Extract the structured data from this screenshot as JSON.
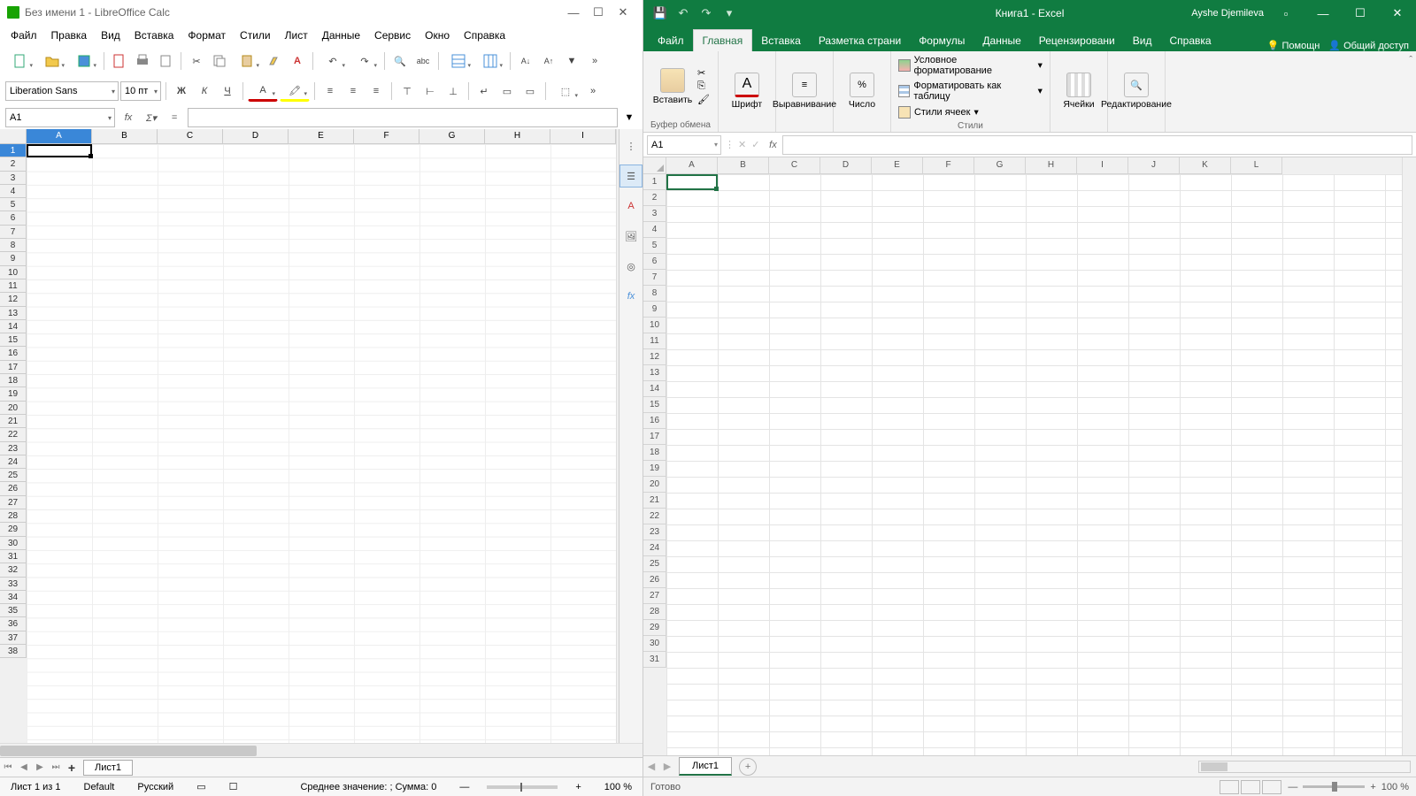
{
  "lo": {
    "title": "Без имени 1 - LibreOffice Calc",
    "menu": [
      "Файл",
      "Правка",
      "Вид",
      "Вставка",
      "Формат",
      "Стили",
      "Лист",
      "Данные",
      "Сервис",
      "Окно",
      "Справка"
    ],
    "font_name": "Liberation Sans",
    "font_size": "10 пт",
    "cell_ref": "A1",
    "cols": [
      "A",
      "B",
      "C",
      "D",
      "E",
      "F",
      "G",
      "H",
      "I"
    ],
    "row_count": 38,
    "sheet_tab": "Лист1",
    "sheet_plus": "+",
    "status": {
      "sheet": "Лист 1 из 1",
      "style": "Default",
      "lang": "Русский",
      "stats": "Среднее значение: ; Сумма: 0",
      "zoom": "100 %"
    }
  },
  "xl": {
    "title": "Книга1  -  Excel",
    "user": "Ayshe Djemileva",
    "tabs": [
      "Файл",
      "Главная",
      "Вставка",
      "Разметка страни",
      "Формулы",
      "Данные",
      "Рецензировани",
      "Вид",
      "Справка"
    ],
    "help": "Помощн",
    "share": "Общий доступ",
    "groups": {
      "clipboard": "Буфер обмена",
      "clipboard_btn": "Вставить",
      "font": "Шрифт",
      "align": "Выравнивание",
      "number": "Число",
      "styles": "Стили",
      "cond": "Условное форматирование",
      "table": "Форматировать как таблицу",
      "cellstyle": "Стили ячеек",
      "cells": "Ячейки",
      "edit": "Редактирование"
    },
    "cell_ref": "A1",
    "cols": [
      "A",
      "B",
      "C",
      "D",
      "E",
      "F",
      "G",
      "H",
      "I",
      "J",
      "K",
      "L"
    ],
    "row_count": 31,
    "sheet_tab": "Лист1",
    "status": {
      "ready": "Готово",
      "zoom": "100 %"
    }
  }
}
